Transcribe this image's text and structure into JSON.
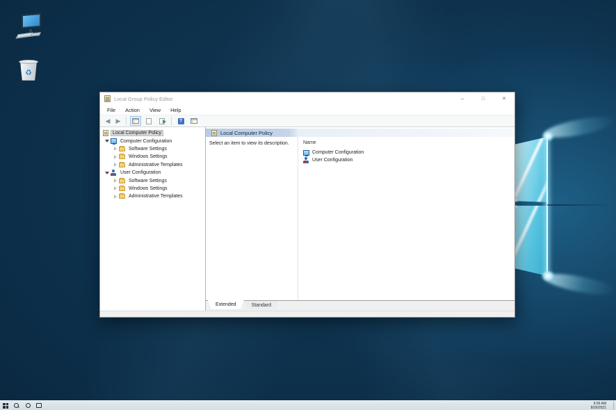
{
  "desktop": {
    "icons": [
      {
        "name": "this-pc"
      },
      {
        "name": "recycle-bin"
      }
    ]
  },
  "window": {
    "title": "Local Group Policy Editor",
    "menu": [
      {
        "label": "File"
      },
      {
        "label": "Action"
      },
      {
        "label": "View"
      },
      {
        "label": "Help"
      }
    ],
    "toolbar_icons": [
      "back",
      "forward",
      "show-console-tree",
      "properties",
      "export-list",
      "help",
      "console-window"
    ],
    "tree": [
      {
        "label": "Local Computer Policy"
      },
      {
        "label": "Computer Configuration"
      },
      {
        "label": "Software Settings"
      },
      {
        "label": "Windows Settings"
      },
      {
        "label": "Administrative Templates"
      },
      {
        "label": "User Configuration"
      },
      {
        "label": "Software Settings"
      },
      {
        "label": "Windows Settings"
      },
      {
        "label": "Administrative Templates"
      }
    ],
    "right": {
      "header": "Local Computer Policy",
      "description": "Select an item to view its description.",
      "name_column": "Name",
      "items": [
        {
          "label": "Computer Configuration"
        },
        {
          "label": "User Configuration"
        }
      ]
    },
    "tabs": [
      {
        "label": "Extended"
      },
      {
        "label": "Standard"
      }
    ]
  },
  "taskbar": {
    "time": "9:06 AM",
    "date": "8/26/2021"
  },
  "colors": {
    "desktop_navy": "#0c2d47",
    "logo_cyan": "#55c3e0",
    "band_blue": "#c6d5ea",
    "selection_gray": "#d8d8d8",
    "taskbar_light": "#dae2e7"
  }
}
